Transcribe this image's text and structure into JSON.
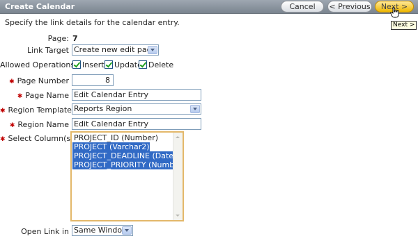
{
  "header": {
    "title": "Create Calendar",
    "buttons": {
      "cancel": "Cancel",
      "previous": "< Previous",
      "next": "Next >"
    },
    "tooltip": "Next >"
  },
  "intro": "Specify the link details for the calendar entry.",
  "form": {
    "page": {
      "label": "Page:",
      "value": "7"
    },
    "link_target": {
      "label": "Link Target",
      "value": "Create new edit page"
    },
    "allowed_operations": {
      "label": "Allowed Operations:",
      "options": [
        {
          "label": "Insert",
          "checked": true
        },
        {
          "label": "Update",
          "checked": true
        },
        {
          "label": "Delete",
          "checked": true
        }
      ]
    },
    "page_number": {
      "label": "Page Number",
      "value": "8",
      "required": true
    },
    "page_name": {
      "label": "Page Name",
      "value": "Edit Calendar Entry",
      "required": true
    },
    "region_template": {
      "label": "Region Template",
      "value": "Reports Region",
      "required": true
    },
    "region_name": {
      "label": "Region Name",
      "value": "Edit Calendar Entry",
      "required": true
    },
    "select_columns": {
      "label": "Select Column(s)",
      "required": true,
      "options": [
        {
          "text": "PROJECT_ID (Number)",
          "selected": false
        },
        {
          "text": "PROJECT (Varchar2)",
          "selected": true
        },
        {
          "text": "PROJECT_DEADLINE (Date)",
          "selected": true
        },
        {
          "text": "PROJECT_PRIORITY (Number)",
          "selected": true
        }
      ]
    },
    "open_link_in": {
      "label": "Open Link in",
      "value": "Same Window"
    }
  },
  "colors": {
    "header_bg": "#8a939d",
    "required_star": "#c00000",
    "selection": "#316ac5",
    "next_button": "#f0b800"
  }
}
